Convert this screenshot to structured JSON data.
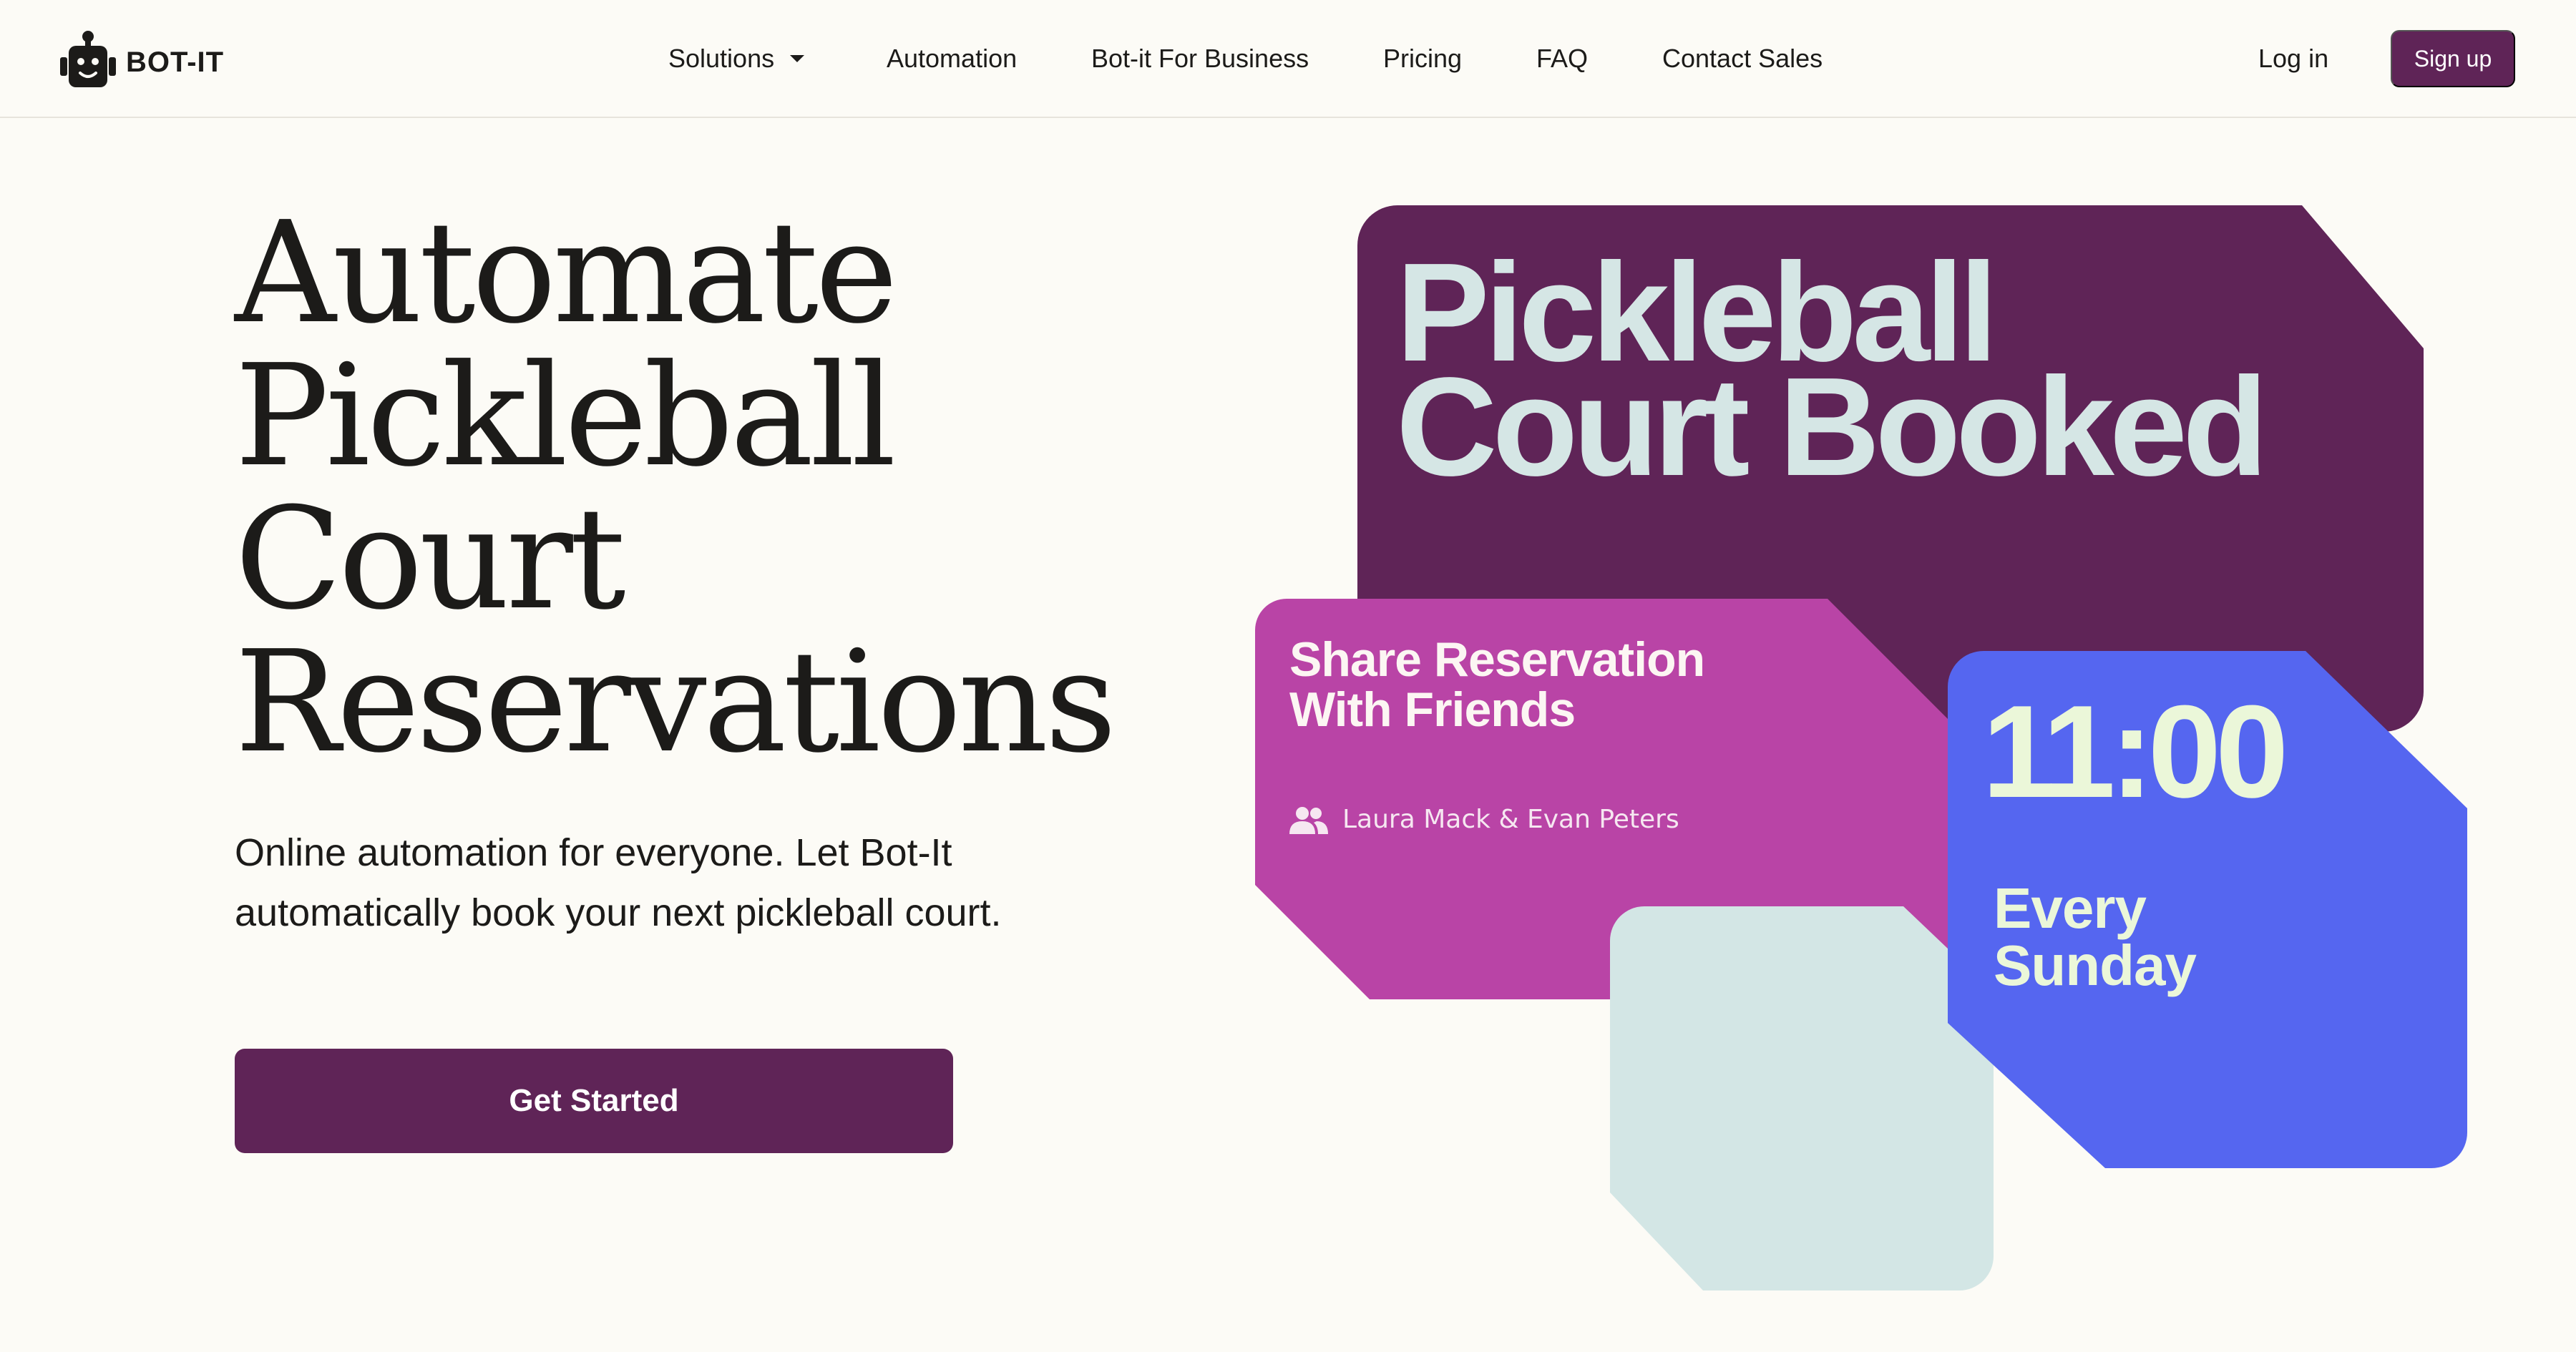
{
  "header": {
    "logo_text": "BOT-IT",
    "logo_icon": "robot-icon",
    "nav": {
      "solutions": "Solutions",
      "automation": "Automation",
      "business": "Bot-it For Business",
      "pricing": "Pricing",
      "faq": "FAQ",
      "contact": "Contact Sales"
    },
    "login": "Log in",
    "signup": "Sign up"
  },
  "hero": {
    "title_lines": [
      "Automate",
      "Pickleball",
      "Court",
      "Reservations"
    ],
    "subtitle": "Online automation for everyone. Let Bot-It automatically book your next pickleball court.",
    "cta": "Get Started"
  },
  "cards": {
    "booked": {
      "title_lines": [
        "Pickleball",
        "Court Booked"
      ]
    },
    "share": {
      "title_lines": [
        "Share Reservation",
        "With Friends"
      ],
      "friends_icon": "people-icon",
      "friends": "Laura Mack & Evan Peters"
    },
    "time": {
      "clock": "11:00",
      "when_lines": [
        "Every",
        "Sunday"
      ]
    }
  },
  "colors": {
    "background": "#fcfbf6",
    "brand_purple": "#5f2457",
    "magenta": "#b944a6",
    "blue": "#5566f0",
    "mint": "#d3e6e5",
    "light_text": "#d5e6e5",
    "lime_text": "#ebf7d9"
  }
}
